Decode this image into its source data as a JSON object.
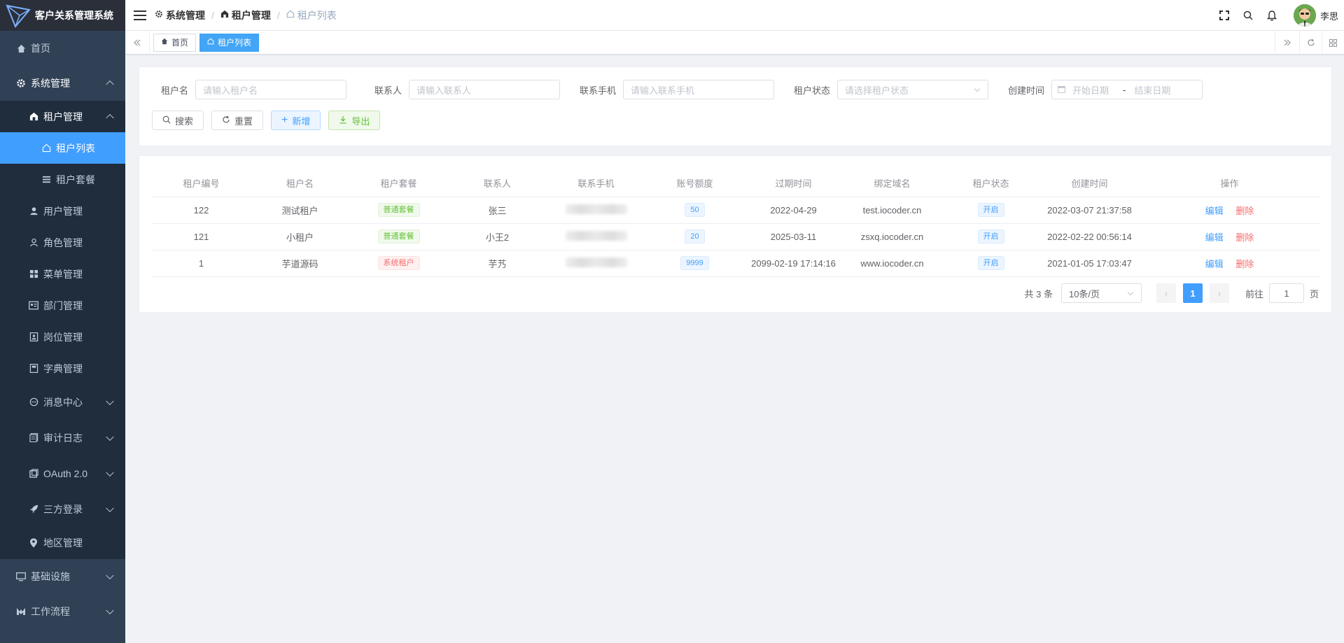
{
  "app": {
    "title": "客户关系管理系统"
  },
  "sidebar": {
    "items": [
      {
        "label": "首页"
      },
      {
        "label": "系统管理"
      },
      {
        "label": "租户管理"
      },
      {
        "label": "租户列表"
      },
      {
        "label": "租户套餐"
      },
      {
        "label": "用户管理"
      },
      {
        "label": "角色管理"
      },
      {
        "label": "菜单管理"
      },
      {
        "label": "部门管理"
      },
      {
        "label": "岗位管理"
      },
      {
        "label": "字典管理"
      },
      {
        "label": "消息中心"
      },
      {
        "label": "审计日志"
      },
      {
        "label": "OAuth 2.0"
      },
      {
        "label": "三方登录"
      },
      {
        "label": "地区管理"
      },
      {
        "label": "基础设施"
      },
      {
        "label": "工作流程"
      }
    ]
  },
  "header": {
    "breadcrumb": [
      "系统管理",
      "租户管理",
      "租户列表"
    ],
    "username": "李思"
  },
  "tags": {
    "home": "首页",
    "current": "租户列表"
  },
  "search": {
    "fields": [
      {
        "label": "租户名",
        "placeholder": "请输入租户名"
      },
      {
        "label": "联系人",
        "placeholder": "请输入联系人"
      },
      {
        "label": "联系手机",
        "placeholder": "请输入联系手机"
      },
      {
        "label": "租户状态",
        "placeholder": "请选择租户状态"
      },
      {
        "label": "创建时间",
        "start": "开始日期",
        "sep": "-",
        "end": "结束日期"
      }
    ],
    "buttons": {
      "search": "搜索",
      "reset": "重置",
      "add": "新增",
      "export": "导出"
    }
  },
  "table": {
    "headers": [
      "租户编号",
      "租户名",
      "租户套餐",
      "联系人",
      "联系手机",
      "账号额度",
      "过期时间",
      "绑定域名",
      "租户状态",
      "创建时间",
      "操作"
    ],
    "rows": [
      {
        "id": "122",
        "name": "测试租户",
        "package": "普通套餐",
        "package_color": "green",
        "contact": "张三",
        "quota": "50",
        "expire": "2022-04-29",
        "domain": "test.iocoder.cn",
        "status": "开启",
        "created": "2022-03-07 21:37:58",
        "edit": "编辑",
        "delete": "删除"
      },
      {
        "id": "121",
        "name": "小租户",
        "package": "普通套餐",
        "package_color": "green",
        "contact": "小王2",
        "quota": "20",
        "expire": "2025-03-11",
        "domain": "zsxq.iocoder.cn",
        "status": "开启",
        "created": "2022-02-22 00:56:14",
        "edit": "编辑",
        "delete": "删除"
      },
      {
        "id": "1",
        "name": "芋道源码",
        "package": "系统租户",
        "package_color": "red",
        "contact": "芋艿",
        "quota": "9999",
        "expire": "2099-02-19 17:14:16",
        "domain": "www.iocoder.cn",
        "status": "开启",
        "created": "2021-01-05 17:03:47",
        "edit": "编辑",
        "delete": "删除"
      }
    ]
  },
  "pagination": {
    "total": "共 3 条",
    "page_size": "10条/页",
    "current": "1",
    "goto_label": "前往",
    "goto_value": "1",
    "page_suffix": "页"
  },
  "colors": {
    "sidebar": "#304156",
    "primary": "#409eff",
    "danger": "#f56c6c",
    "success": "#67c23a"
  }
}
